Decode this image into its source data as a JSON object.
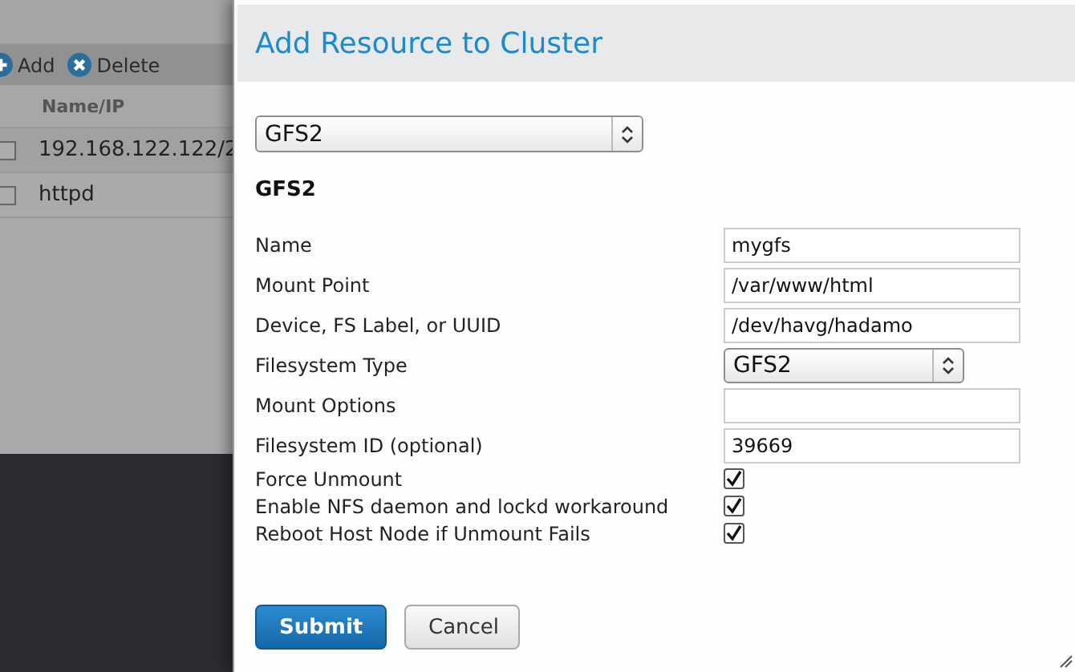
{
  "background": {
    "toolbar": [
      {
        "kind": "add",
        "label": "Add"
      },
      {
        "kind": "delete",
        "label": "Delete"
      }
    ],
    "table": {
      "columns": [
        "Name/IP"
      ],
      "rows": [
        {
          "checked": false,
          "name": "192.168.122.122/2"
        },
        {
          "checked": false,
          "name": "httpd"
        }
      ]
    }
  },
  "dialog": {
    "title": "Add Resource to Cluster",
    "resource_type": "GFS2",
    "section_title": "GFS2",
    "fields": [
      {
        "kind": "text",
        "label": "Name",
        "value": "mygfs"
      },
      {
        "kind": "text",
        "label": "Mount Point",
        "value": "/var/www/html"
      },
      {
        "kind": "text",
        "label": "Device, FS Label, or UUID",
        "value": "/dev/havg/hadamo"
      },
      {
        "kind": "select",
        "label": "Filesystem Type",
        "value": "GFS2"
      },
      {
        "kind": "text",
        "label": "Mount Options"
      },
      {
        "kind": "text",
        "label": "Filesystem ID (optional)",
        "value": "39669"
      },
      {
        "kind": "checkbox",
        "label": "Force Unmount",
        "checked": true
      },
      {
        "kind": "checkbox",
        "label": "Enable NFS daemon and lockd workaround",
        "checked": true
      },
      {
        "kind": "checkbox",
        "label": "Reboot Host Node if Unmount Fails",
        "checked": true
      }
    ],
    "buttons": [
      {
        "kind": "primary",
        "label": "Submit"
      },
      {
        "kind": "secondary",
        "label": "Cancel"
      }
    ]
  }
}
